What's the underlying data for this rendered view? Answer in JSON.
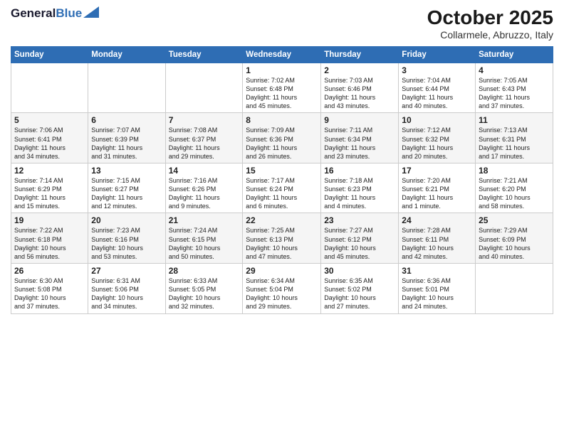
{
  "header": {
    "logo_line1": "General",
    "logo_line2": "Blue",
    "month": "October 2025",
    "location": "Collarmele, Abruzzo, Italy"
  },
  "weekdays": [
    "Sunday",
    "Monday",
    "Tuesday",
    "Wednesday",
    "Thursday",
    "Friday",
    "Saturday"
  ],
  "weeks": [
    [
      {
        "day": "",
        "info": ""
      },
      {
        "day": "",
        "info": ""
      },
      {
        "day": "",
        "info": ""
      },
      {
        "day": "1",
        "info": "Sunrise: 7:02 AM\nSunset: 6:48 PM\nDaylight: 11 hours\nand 45 minutes."
      },
      {
        "day": "2",
        "info": "Sunrise: 7:03 AM\nSunset: 6:46 PM\nDaylight: 11 hours\nand 43 minutes."
      },
      {
        "day": "3",
        "info": "Sunrise: 7:04 AM\nSunset: 6:44 PM\nDaylight: 11 hours\nand 40 minutes."
      },
      {
        "day": "4",
        "info": "Sunrise: 7:05 AM\nSunset: 6:43 PM\nDaylight: 11 hours\nand 37 minutes."
      }
    ],
    [
      {
        "day": "5",
        "info": "Sunrise: 7:06 AM\nSunset: 6:41 PM\nDaylight: 11 hours\nand 34 minutes."
      },
      {
        "day": "6",
        "info": "Sunrise: 7:07 AM\nSunset: 6:39 PM\nDaylight: 11 hours\nand 31 minutes."
      },
      {
        "day": "7",
        "info": "Sunrise: 7:08 AM\nSunset: 6:37 PM\nDaylight: 11 hours\nand 29 minutes."
      },
      {
        "day": "8",
        "info": "Sunrise: 7:09 AM\nSunset: 6:36 PM\nDaylight: 11 hours\nand 26 minutes."
      },
      {
        "day": "9",
        "info": "Sunrise: 7:11 AM\nSunset: 6:34 PM\nDaylight: 11 hours\nand 23 minutes."
      },
      {
        "day": "10",
        "info": "Sunrise: 7:12 AM\nSunset: 6:32 PM\nDaylight: 11 hours\nand 20 minutes."
      },
      {
        "day": "11",
        "info": "Sunrise: 7:13 AM\nSunset: 6:31 PM\nDaylight: 11 hours\nand 17 minutes."
      }
    ],
    [
      {
        "day": "12",
        "info": "Sunrise: 7:14 AM\nSunset: 6:29 PM\nDaylight: 11 hours\nand 15 minutes."
      },
      {
        "day": "13",
        "info": "Sunrise: 7:15 AM\nSunset: 6:27 PM\nDaylight: 11 hours\nand 12 minutes."
      },
      {
        "day": "14",
        "info": "Sunrise: 7:16 AM\nSunset: 6:26 PM\nDaylight: 11 hours\nand 9 minutes."
      },
      {
        "day": "15",
        "info": "Sunrise: 7:17 AM\nSunset: 6:24 PM\nDaylight: 11 hours\nand 6 minutes."
      },
      {
        "day": "16",
        "info": "Sunrise: 7:18 AM\nSunset: 6:23 PM\nDaylight: 11 hours\nand 4 minutes."
      },
      {
        "day": "17",
        "info": "Sunrise: 7:20 AM\nSunset: 6:21 PM\nDaylight: 11 hours\nand 1 minute."
      },
      {
        "day": "18",
        "info": "Sunrise: 7:21 AM\nSunset: 6:20 PM\nDaylight: 10 hours\nand 58 minutes."
      }
    ],
    [
      {
        "day": "19",
        "info": "Sunrise: 7:22 AM\nSunset: 6:18 PM\nDaylight: 10 hours\nand 56 minutes."
      },
      {
        "day": "20",
        "info": "Sunrise: 7:23 AM\nSunset: 6:16 PM\nDaylight: 10 hours\nand 53 minutes."
      },
      {
        "day": "21",
        "info": "Sunrise: 7:24 AM\nSunset: 6:15 PM\nDaylight: 10 hours\nand 50 minutes."
      },
      {
        "day": "22",
        "info": "Sunrise: 7:25 AM\nSunset: 6:13 PM\nDaylight: 10 hours\nand 47 minutes."
      },
      {
        "day": "23",
        "info": "Sunrise: 7:27 AM\nSunset: 6:12 PM\nDaylight: 10 hours\nand 45 minutes."
      },
      {
        "day": "24",
        "info": "Sunrise: 7:28 AM\nSunset: 6:11 PM\nDaylight: 10 hours\nand 42 minutes."
      },
      {
        "day": "25",
        "info": "Sunrise: 7:29 AM\nSunset: 6:09 PM\nDaylight: 10 hours\nand 40 minutes."
      }
    ],
    [
      {
        "day": "26",
        "info": "Sunrise: 6:30 AM\nSunset: 5:08 PM\nDaylight: 10 hours\nand 37 minutes."
      },
      {
        "day": "27",
        "info": "Sunrise: 6:31 AM\nSunset: 5:06 PM\nDaylight: 10 hours\nand 34 minutes."
      },
      {
        "day": "28",
        "info": "Sunrise: 6:33 AM\nSunset: 5:05 PM\nDaylight: 10 hours\nand 32 minutes."
      },
      {
        "day": "29",
        "info": "Sunrise: 6:34 AM\nSunset: 5:04 PM\nDaylight: 10 hours\nand 29 minutes."
      },
      {
        "day": "30",
        "info": "Sunrise: 6:35 AM\nSunset: 5:02 PM\nDaylight: 10 hours\nand 27 minutes."
      },
      {
        "day": "31",
        "info": "Sunrise: 6:36 AM\nSunset: 5:01 PM\nDaylight: 10 hours\nand 24 minutes."
      },
      {
        "day": "",
        "info": ""
      }
    ]
  ]
}
